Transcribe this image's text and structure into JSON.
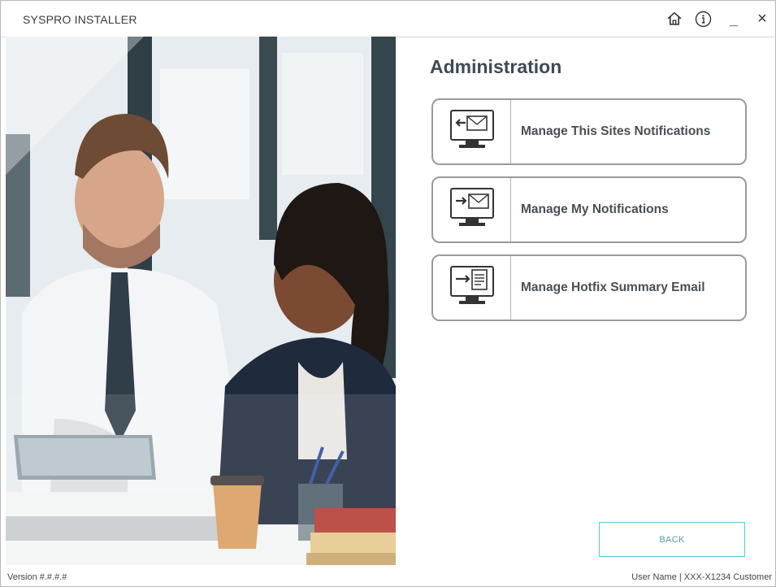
{
  "app": {
    "title": "SYSPRO INSTALLER"
  },
  "titlebar": {
    "icons": [
      "home-icon",
      "info-icon",
      "minimize-icon",
      "close-icon"
    ],
    "minimize_label": "_",
    "close_label": "×"
  },
  "main": {
    "heading": "Administration",
    "cards": [
      {
        "label": "Manage This Sites Notifications",
        "icon": "mail-incoming-monitor-icon"
      },
      {
        "label": "Manage My Notifications",
        "icon": "mail-outgoing-monitor-icon"
      },
      {
        "label": "Manage Hotfix Summary Email",
        "icon": "document-monitor-icon"
      }
    ],
    "back_label": "BACK"
  },
  "footer": {
    "version": "Version #.#.#.#",
    "user": "User Name | XXX-X1234 Customer"
  },
  "colors": {
    "accent": "#5cc6d6",
    "card_border": "#9a9a9a",
    "heading": "#3e4a54"
  }
}
